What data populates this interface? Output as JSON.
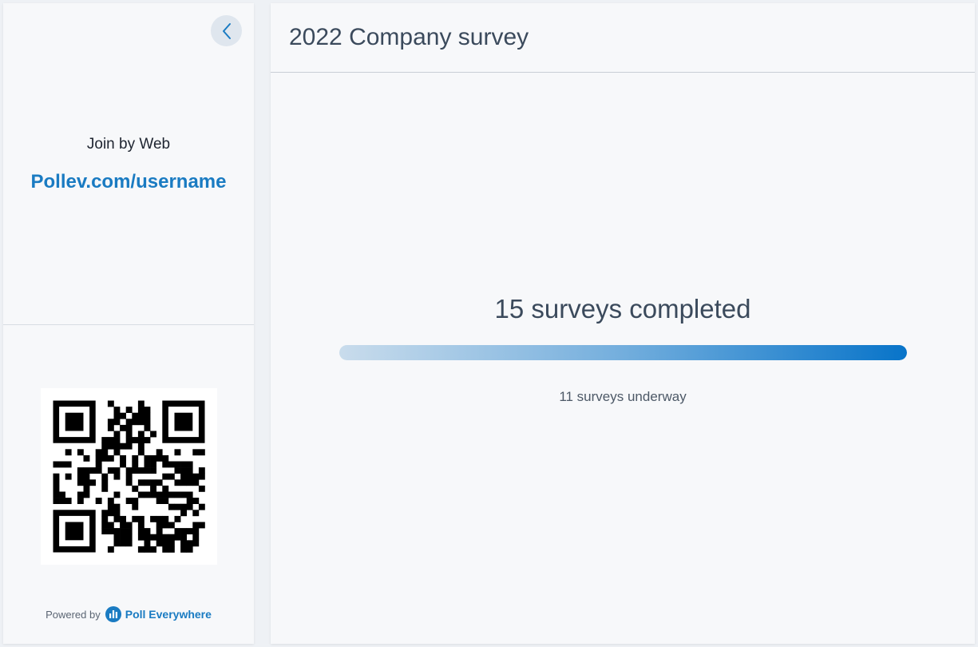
{
  "sidebar": {
    "join_label": "Join by Web",
    "join_url": "Pollev.com/username",
    "powered_by": "Powered by",
    "brand_name": "Poll Everywhere",
    "collapse_icon": "chevron-left-icon"
  },
  "main": {
    "title": "2022 Company survey",
    "completed_text": "15 surveys completed",
    "progress": 1.0,
    "underway_text": "11 surveys underway"
  },
  "colors": {
    "accent": "#1a7bc2",
    "text": "#3b4a5c",
    "progress_end": "#0874c9",
    "progress_start": "#c9dcec"
  }
}
